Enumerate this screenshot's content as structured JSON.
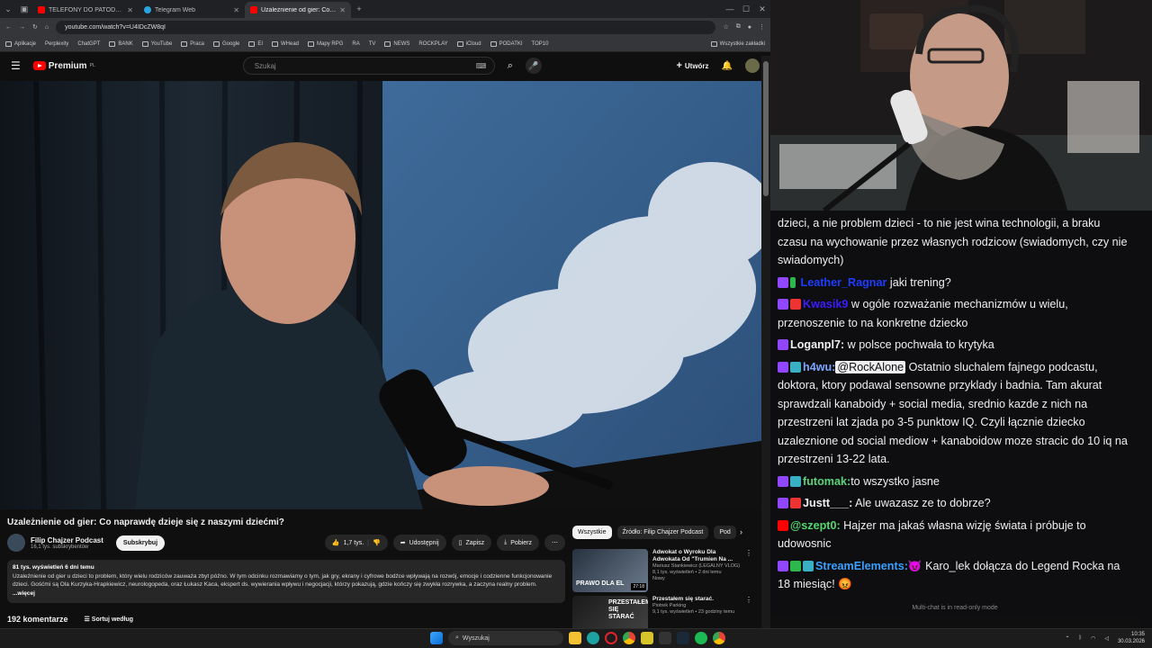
{
  "browser": {
    "tabs": [
      {
        "label": "TELEFONY DO PATODEWELOP",
        "color": "#ff0000",
        "active": false
      },
      {
        "label": "Telegram Web",
        "color": "#2aa3df",
        "active": false
      },
      {
        "label": "Uzależnienie od gier: Co napra",
        "color": "#ff0000",
        "active": true
      }
    ],
    "new_tab": "+",
    "url": "youtube.com/watch?v=U4IDcZW8qI",
    "bookmarks": [
      "Aplikacje",
      "Perplexity",
      "ChatGPT",
      "BANK",
      "YouTube",
      "Praca",
      "Google",
      "EI",
      "WHead",
      "Mapy RPG",
      "RA",
      "TV",
      "NEWS",
      "ROCKPLAY",
      "iCloud",
      "PODATKI",
      "TOP10"
    ],
    "all_bookmarks": "Wszystkie zakładki"
  },
  "youtube": {
    "logo": "Premium",
    "logo_region": "PL",
    "search_placeholder": "Szukaj",
    "create": "Utwórz",
    "video_title": "Uzależnienie od gier: Co naprawdę dzieje się z naszymi dziećmi?",
    "channel": {
      "name": "Filip Chajzer Podcast",
      "subs": "16,1 tys. subskrybentów",
      "subscribe": "Subskrybuj"
    },
    "actions": {
      "likes": "1,7 tys.",
      "share": "Udostępnij",
      "save": "Zapisz",
      "download": "Pobierz",
      "more": "⋯"
    },
    "description": {
      "meta": "81 tys. wyświetleń  6 dni temu",
      "text": "Uzależnienie od gier u dzieci to problem, który wielu rodziców zauważa zbyt późno. W tym odcinku rozmawiamy o tym, jak gry, ekrany i cyfrowe bodźce wpływają na rozwój, emocje i codzienne funkcjonowanie dzieci. Gośćmi są Ola Kurzyka-Hrapkiewicz, neurologopeda, oraz Łukasz Kaca, ekspert ds. wywierania wpływu i negocjacji, którzy pokazują, gdzie kończy się zwykła rozrywka, a zaczyna realny problem.",
      "more": "...więcej"
    },
    "comments": {
      "count": "192 komentarze",
      "sort": "Sortuj według"
    },
    "chips": [
      "Wszystkie",
      "Źródło: Filip Chajzer Podcast",
      "Pod"
    ],
    "recommendations": [
      {
        "title": "Adwokat o Wyroku Dla Adwokata Od \"Trumien Na ...",
        "channel": "Mariusz Stankiewicz (LEGALNY VLOG)",
        "views": "8,1 tys. wyświetleń • 2 dni temu",
        "badge": "Nowy",
        "duration": "27:18",
        "thumb_text": "PRAWO DLA EL"
      },
      {
        "title": "Przestałem się starać.",
        "channel": "Piotrek Parking",
        "views": "9,1 tys. wyświetleń • 23 godziny temu",
        "badge": "",
        "duration": "",
        "thumb_text": "PRZESTAŁEM SIĘ STARAĆ"
      }
    ]
  },
  "chat": {
    "messages": [
      {
        "badges": [],
        "user": "",
        "user_color": "#efeff1",
        "text": "dzieci, a nie problem dzieci - to nie jest wina technologii, a braku czasu na wychowanie przez własnych rodzicow (swiadomych, czy nie swiadomych)"
      },
      {
        "badges": [
          "tw",
          "grn"
        ],
        "user": "Leather_Ragnar",
        "user_color": "#1e3cff",
        "text": "jaki trening?"
      },
      {
        "badges": [
          "tw",
          "red"
        ],
        "user": "Kwasik9",
        "user_color": "#3b1cff",
        "text": "w ogóle rozważanie mechanizmów u wielu, przenoszenie to na konkretne dziecko"
      },
      {
        "badges": [
          "tw"
        ],
        "user": "Loganpl7:",
        "user_color": "#efeff1",
        "text": "w polsce pochwała to krytyka"
      },
      {
        "badges": [
          "tw",
          "tl"
        ],
        "user": "h4wu:",
        "user_color": "#7aa6ff",
        "mention": "@RockAlone",
        "text": "Ostatnio sluchalem fajnego podcastu, doktora, ktory podawal sensowne przyklady i badnia. Tam akurat sprawdzali kanaboidy + social media, srednio kazde z nich na przestrzeni lat zjada po 3-5 punktow IQ. Czyli łącznie dziecko uzaleznione od social mediow + kanaboidow moze stracic do 10 iq na przestrzeni 13-22 lata."
      },
      {
        "badges": [
          "tw",
          "tl"
        ],
        "user": "futomak:",
        "user_color": "#5ad37a",
        "text": "to wszystko jasne"
      },
      {
        "badges": [
          "tw",
          "red"
        ],
        "user": "Justt___:",
        "user_color": "#efeff1",
        "text": "Ale uwazasz ze to dobrze?"
      },
      {
        "badges": [
          "yt"
        ],
        "user": "@szept0:",
        "user_color": "#54d86e",
        "text": "Hajzer ma jakaś własna wizję świata i próbuje to udowosnic"
      },
      {
        "badges": [
          "tw",
          "grn",
          "tl"
        ],
        "user": "StreamElements:",
        "user_color": "#3aa0ff",
        "text": "Karo_lek dołącza do Legend Rocka na 18 miesiąc!"
      }
    ],
    "footer": "Multi-chat is in read-only mode"
  },
  "taskbar": {
    "search": "Wyszukaj",
    "time": "10:35",
    "date": "30.03.2026"
  },
  "colors": {
    "yt_red": "#ff0000",
    "twitch": "#9147ff",
    "chat_bg": "#0e0e10"
  }
}
